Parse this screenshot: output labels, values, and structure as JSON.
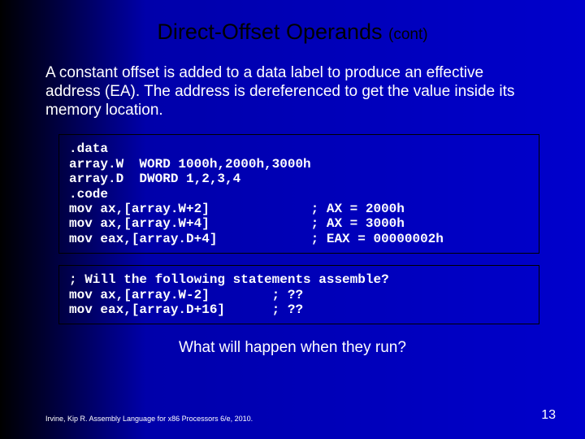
{
  "title_main": "Direct-Offset Operands ",
  "title_cont": "(cont)",
  "paragraph": "A constant offset is added to a data label to produce an effective address (EA). The address is dereferenced to get the value inside its memory location.",
  "code1": ".data\narray.W  WORD 1000h,2000h,3000h\narray.D  DWORD 1,2,3,4\n.code\nmov ax,[array.W+2]             ; AX = 2000h\nmov ax,[array.W+4]             ; AX = 3000h\nmov eax,[array.D+4]            ; EAX = 00000002h",
  "code2": "; Will the following statements assemble?\nmov ax,[array.W-2]        ; ??\nmov eax,[array.D+16]      ; ??",
  "question": "What will happen when they run?",
  "footer": "Irvine, Kip R. Assembly Language for x86 Processors 6/e, 2010.",
  "page": "13"
}
